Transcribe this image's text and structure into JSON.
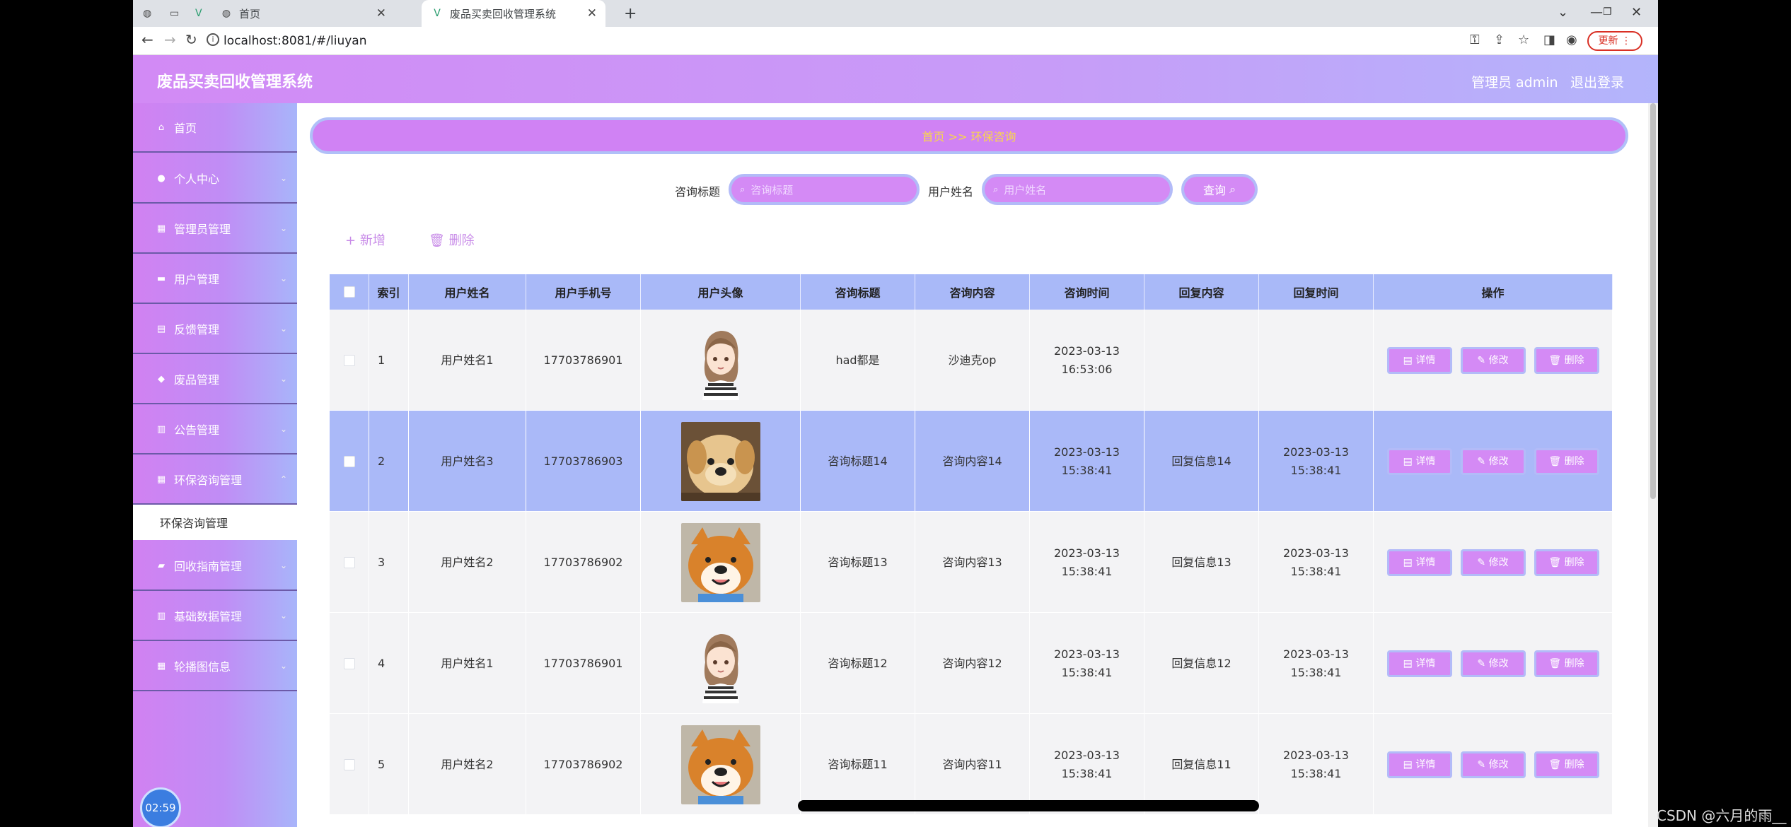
{
  "browser": {
    "tabs": [
      {
        "label": ""
      },
      {
        "label": ""
      },
      {
        "label": ""
      },
      {
        "label": "首页"
      },
      {
        "label": "废品买卖回收管理系统"
      }
    ],
    "new_tab": "+",
    "url": "localhost:8081/#/liuyan",
    "update_label": "更新"
  },
  "header": {
    "title": "废品买卖回收管理系统",
    "admin_label": "管理员 admin",
    "logout_label": "退出登录"
  },
  "sidebar": {
    "items": [
      {
        "label": "首页",
        "icon": "home-icon"
      },
      {
        "label": "个人中心",
        "icon": "user-icon"
      },
      {
        "label": "管理员管理",
        "icon": "grid-icon"
      },
      {
        "label": "用户管理",
        "icon": "monitor-icon"
      },
      {
        "label": "反馈管理",
        "icon": "inbox-icon"
      },
      {
        "label": "废品管理",
        "icon": "location-icon"
      },
      {
        "label": "公告管理",
        "icon": "document-icon"
      },
      {
        "label": "环保咨询管理",
        "icon": "grid-icon"
      }
    ],
    "sub_item": "环保咨询管理",
    "items_after": [
      {
        "label": "回收指南管理",
        "icon": "ticket-icon"
      },
      {
        "label": "基础数据管理",
        "icon": "document-icon"
      },
      {
        "label": "轮播图信息",
        "icon": "grid-icon"
      }
    ],
    "timer": "02:59"
  },
  "breadcrumb": "首页 >> 环保咨询",
  "search": {
    "title_label": "咨询标题",
    "title_placeholder": "咨询标题",
    "name_label": "用户姓名",
    "name_placeholder": "用户姓名",
    "button_label": "查询"
  },
  "actions": {
    "add_label": "新增",
    "delete_label": "删除"
  },
  "table": {
    "columns": [
      "",
      "索引",
      "用户姓名",
      "用户手机号",
      "用户头像",
      "咨询标题",
      "咨询内容",
      "咨询时间",
      "回复内容",
      "回复时间",
      "操作"
    ],
    "rows": [
      {
        "index": "1",
        "name": "用户姓名1",
        "phone": "17703786901",
        "avatar": "girl",
        "title": "had都是",
        "content": "沙迪克op",
        "time": "2023-03-13 16:53:06",
        "reply": "",
        "reply_time": ""
      },
      {
        "index": "2",
        "name": "用户姓名3",
        "phone": "17703786903",
        "avatar": "puppy",
        "title": "咨询标题14",
        "content": "咨询内容14",
        "time": "2023-03-13 15:38:41",
        "reply": "回复信息14",
        "reply_time": "2023-03-13 15:38:41"
      },
      {
        "index": "3",
        "name": "用户姓名2",
        "phone": "17703786902",
        "avatar": "shiba",
        "title": "咨询标题13",
        "content": "咨询内容13",
        "time": "2023-03-13 15:38:41",
        "reply": "回复信息13",
        "reply_time": "2023-03-13 15:38:41"
      },
      {
        "index": "4",
        "name": "用户姓名1",
        "phone": "17703786901",
        "avatar": "girl",
        "title": "咨询标题12",
        "content": "咨询内容12",
        "time": "2023-03-13 15:38:41",
        "reply": "回复信息12",
        "reply_time": "2023-03-13 15:38:41"
      },
      {
        "index": "5",
        "name": "用户姓名2",
        "phone": "17703786902",
        "avatar": "shiba",
        "title": "咨询标题11",
        "content": "咨询内容11",
        "time": "2023-03-13 15:38:41",
        "reply": "回复信息11",
        "reply_time": "2023-03-13 15:38:41"
      }
    ],
    "op_labels": {
      "detail": "详情",
      "edit": "修改",
      "delete": "删除"
    }
  },
  "watermark": "CSDN @六月的雨__",
  "colors": {
    "accent": "#d48af5",
    "header_end": "#b3b5fb",
    "highlight_row": "#aab9f8",
    "breadcrumb_text": "#f9d74a"
  }
}
